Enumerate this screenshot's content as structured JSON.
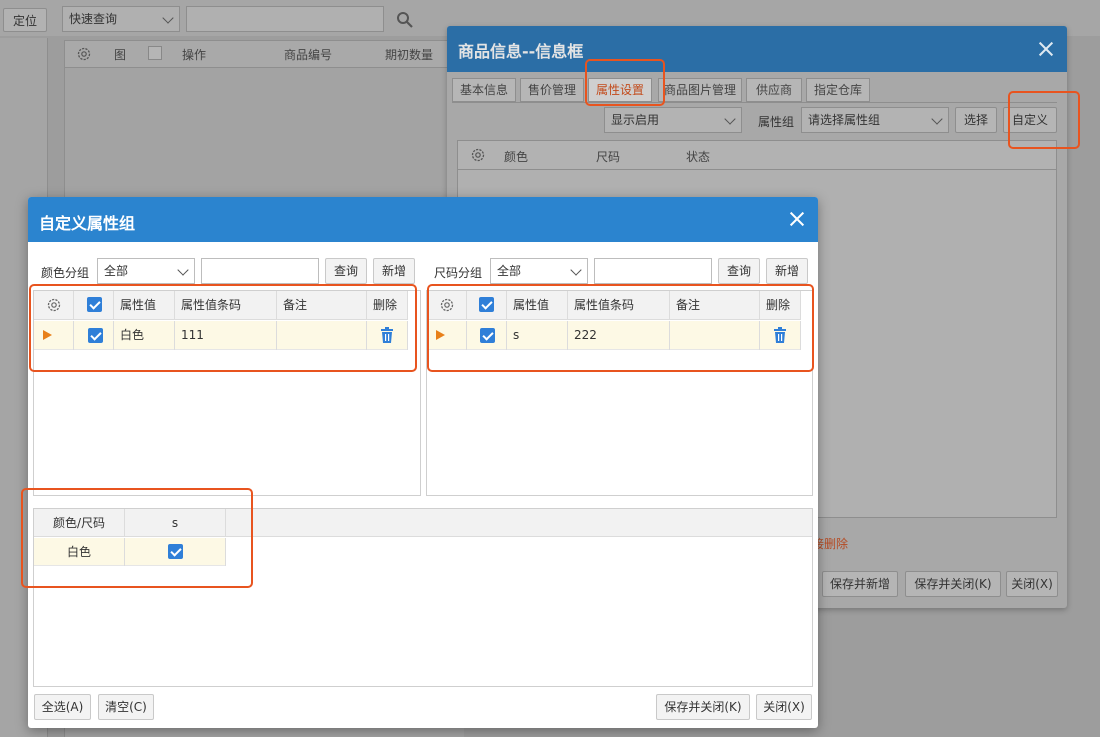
{
  "background": {
    "locate_label": "定位",
    "quick_query": "快速查询",
    "columns": [
      "图",
      "操作",
      "商品编号",
      "期初数量"
    ]
  },
  "info_dialog": {
    "title": "商品信息--信息框",
    "tabs": [
      "基本信息",
      "售价管理",
      "属性设置",
      "商品图片管理",
      "供应商",
      "指定仓库"
    ],
    "display_select": "显示启用",
    "attr_group_label": "属性组",
    "attr_group_select": "请选择属性组",
    "select_button": "选择",
    "custom_button": "自定义",
    "columns": [
      "颜色",
      "尺码",
      "状态"
    ],
    "partial_link": "接删除",
    "footer": [
      "保存并新增",
      "保存并关闭(K)",
      "关闭(X)"
    ]
  },
  "custom_dialog": {
    "title": "自定义属性组",
    "color_group": {
      "label": "颜色分组",
      "select": "全部",
      "query": "查询",
      "add": "新增",
      "columns": [
        "属性值",
        "属性值条码",
        "备注",
        "删除"
      ],
      "rows": [
        {
          "value": "白色",
          "barcode": "111",
          "note": ""
        }
      ]
    },
    "size_group": {
      "label": "尺码分组",
      "select": "全部",
      "query": "查询",
      "add": "新增",
      "columns": [
        "属性值",
        "属性值条码",
        "备注",
        "删除"
      ],
      "rows": [
        {
          "value": "s",
          "barcode": "222",
          "note": ""
        }
      ]
    },
    "matrix": {
      "corner": "颜色/尺码",
      "size_header": "s",
      "row_label": "白色"
    },
    "footer": {
      "select_all": "全选(A)",
      "clear": "清空(C)",
      "save_close": "保存并关闭(K)",
      "close": "关闭(X)"
    }
  },
  "colors": {
    "accent": "#2b84cf",
    "highlight": "#e8541f",
    "row_selected": "#fdf9e5"
  }
}
